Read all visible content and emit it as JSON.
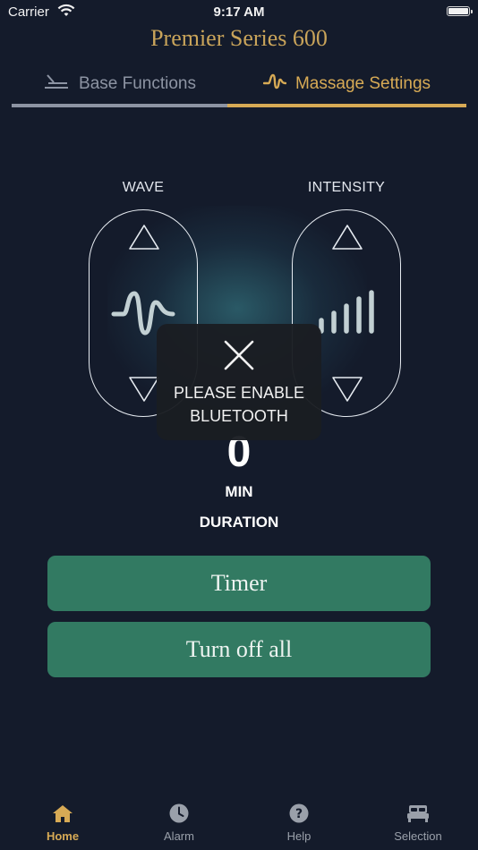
{
  "status_bar": {
    "carrier": "Carrier",
    "time": "9:17 AM"
  },
  "app_title": "Premier Series 600",
  "tabs": [
    {
      "label": "Base Functions",
      "icon": "bed-recline-icon",
      "selected": false
    },
    {
      "label": "Massage Settings",
      "icon": "wave-icon",
      "selected": true
    }
  ],
  "controls": {
    "wave": {
      "label": "WAVE",
      "icon": "wave-icon"
    },
    "intensity": {
      "label": "INTENSITY",
      "icon": "signal-bars-icon",
      "level": 5,
      "max": 5
    }
  },
  "duration": {
    "value": "0",
    "unit": "MIN",
    "label": "DURATION"
  },
  "buttons": {
    "timer": "Timer",
    "turn_off_all": "Turn off all"
  },
  "toast": {
    "icon": "close-icon",
    "message_line1": "PLEASE ENABLE",
    "message_line2": "BLUETOOTH"
  },
  "tab_bar": [
    {
      "label": "Home",
      "icon": "home-icon",
      "active": true
    },
    {
      "label": "Alarm",
      "icon": "clock-icon",
      "active": false
    },
    {
      "label": "Help",
      "icon": "help-icon",
      "active": false
    },
    {
      "label": "Selection",
      "icon": "bed-icon",
      "active": false
    }
  ],
  "colors": {
    "background": "#141b2b",
    "accent": "#d7aa55",
    "button": "#327a62",
    "inactive": "#8d94a3"
  }
}
